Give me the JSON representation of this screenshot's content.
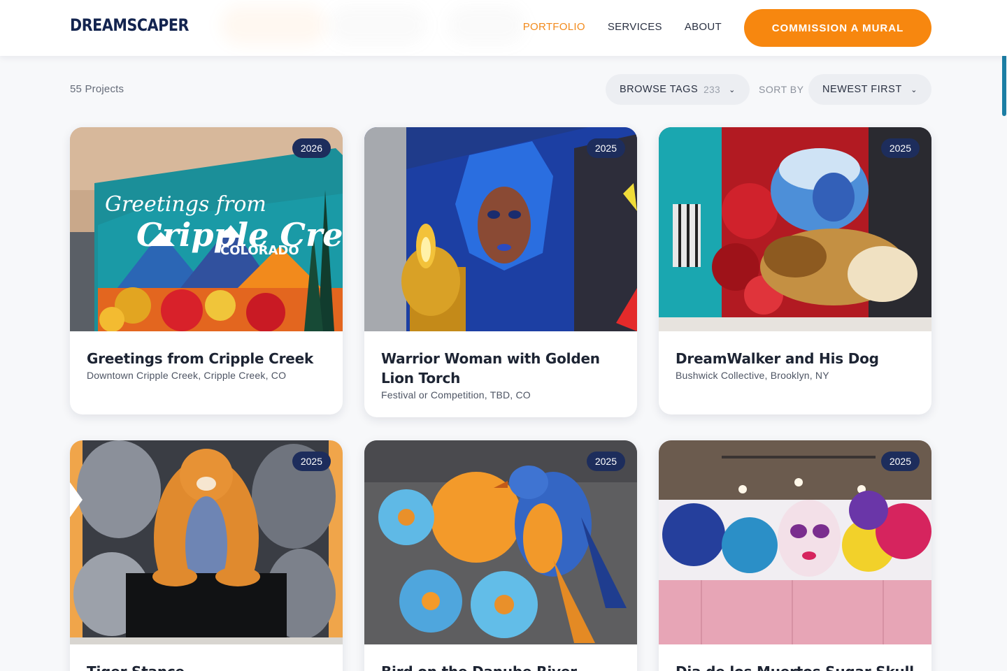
{
  "header": {
    "logo": "DREAMSCAPER",
    "nav": [
      {
        "label": "PORTFOLIO",
        "active": true
      },
      {
        "label": "SERVICES",
        "active": false
      },
      {
        "label": "ABOUT",
        "active": false
      }
    ],
    "cta_label": "COMMISSION A MURAL"
  },
  "toolbar": {
    "project_count": "55 Projects",
    "browse_tags_label": "BROWSE TAGS",
    "browse_tags_count": "233",
    "sort_label": "SORT BY",
    "sort_value": "NEWEST FIRST"
  },
  "projects": [
    {
      "year": "2026",
      "title": "Greetings from Cripple Creek",
      "location": "Downtown Cripple Creek, Cripple Creek, CO",
      "image_text_1": "Greetings from",
      "image_text_2": "Cripple Creek",
      "image_text_3": "COLORADO"
    },
    {
      "year": "2025",
      "title": "Warrior Woman with Golden Lion Torch",
      "location": "Festival or Competition, TBD, CO"
    },
    {
      "year": "2025",
      "title": "DreamWalker and His Dog",
      "location": "Bushwick Collective, Brooklyn, NY"
    },
    {
      "year": "2025",
      "title": "Tiger Stance",
      "location": ""
    },
    {
      "year": "2025",
      "title": "Bird on the Danube River",
      "location": ""
    },
    {
      "year": "2025",
      "title": "Dia de los Muertos Sugar Skull",
      "location": ""
    }
  ],
  "theme": {
    "accent": "#f7870f",
    "navy": "#1d2d5c",
    "scrollbar": "#1b7ea4"
  },
  "icons": [
    "chevron-down-icon"
  ]
}
